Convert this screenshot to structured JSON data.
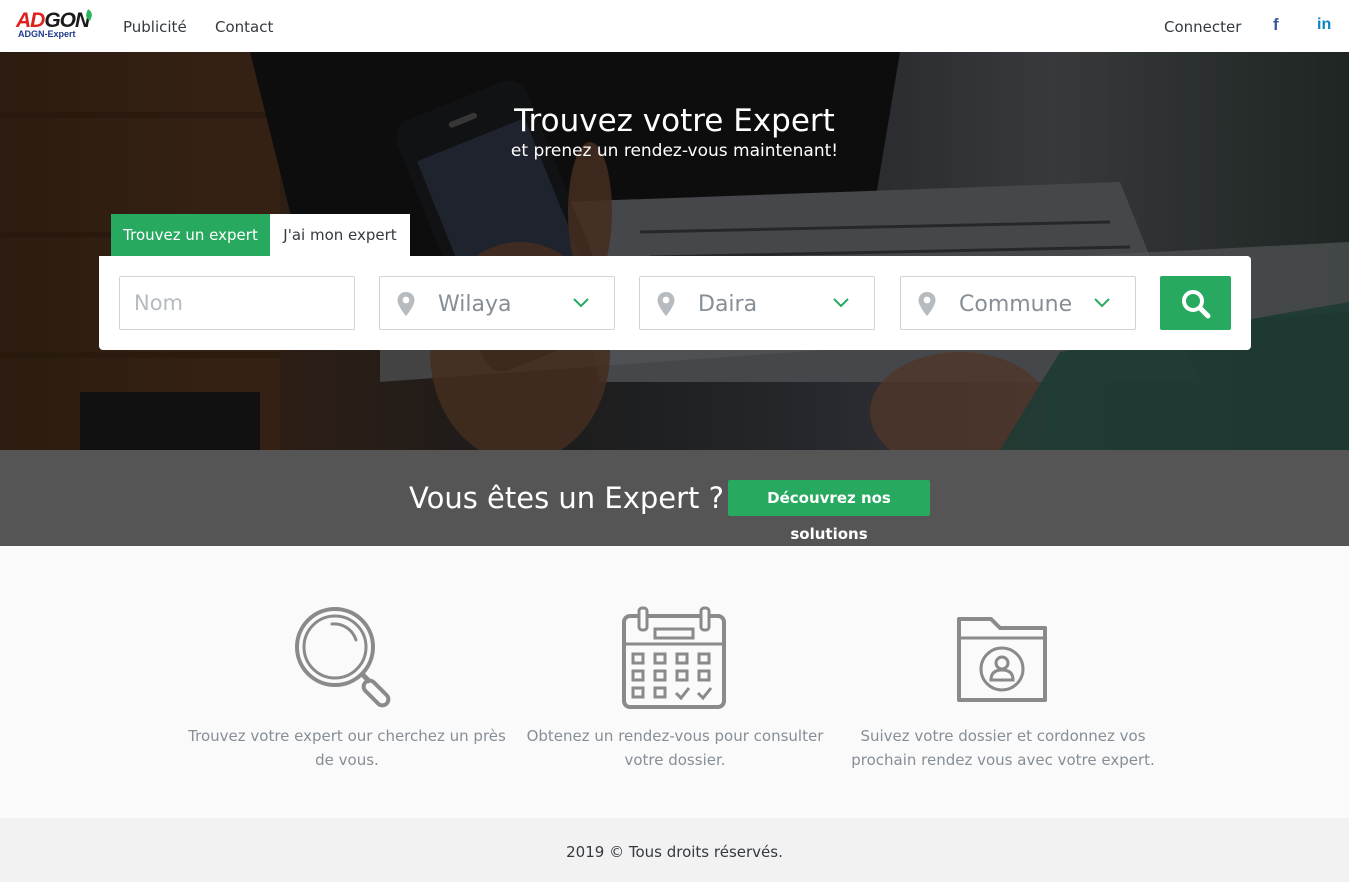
{
  "navbar": {
    "logo_main_left": "AD",
    "logo_main_right": "GON",
    "logo_sub": "ADGN-Expert",
    "links": [
      "Publicité",
      "Contact"
    ],
    "connect_label": "Connecter",
    "facebook_glyph": "f",
    "linkedin_glyph": "in"
  },
  "hero": {
    "title": "Trouvez votre Expert",
    "subtitle": "et prenez un rendez-vous maintenant!",
    "tabs": [
      "Trouvez un expert",
      "J'ai mon expert"
    ],
    "search": {
      "name_placeholder": "Nom",
      "wilaya_label": "Wilaya",
      "daira_label": "Daira",
      "commune_label": "Commune"
    }
  },
  "expert_bar": {
    "question": "Vous êtes un Expert ?",
    "button_label": "Découvrez nos solutions"
  },
  "features": [
    {
      "icon": "magnifier-icon",
      "text": "Trouvez votre expert our cherchez un près de vous."
    },
    {
      "icon": "calendar-icon",
      "text": "Obtenez un rendez-vous pour consulter votre dossier."
    },
    {
      "icon": "folder-user-icon",
      "text": "Suivez votre dossier et cordonnez vos prochain rendez vous avec votre expert."
    }
  ],
  "footer": {
    "text": "2019 © Tous droits réservés."
  },
  "colors": {
    "accent": "#28a960",
    "expert_bar_bg": "#555555",
    "facebook": "#3b5998",
    "linkedin": "#0a84c1"
  }
}
